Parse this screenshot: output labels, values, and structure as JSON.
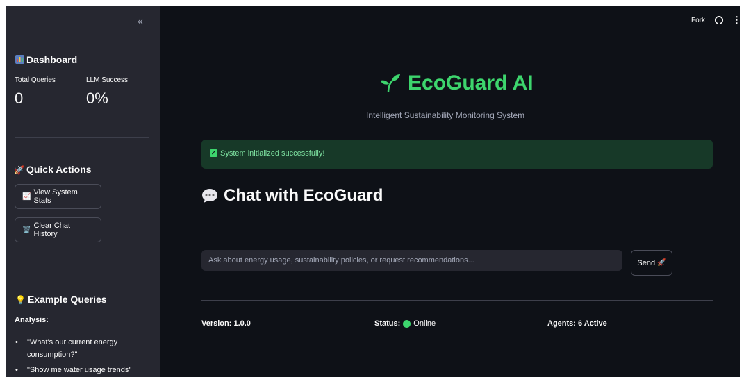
{
  "sidebar": {
    "collapse_icon": "double-chevron-left-icon",
    "dashboard": {
      "title": "Dashboard",
      "icon": "bar-chart-icon",
      "metrics": [
        {
          "label": "Total Queries",
          "value": "0"
        },
        {
          "label": "LLM Success",
          "value": "0%"
        }
      ]
    },
    "quick_actions": {
      "title": "Quick Actions",
      "icon": "rocket-icon",
      "buttons": [
        {
          "label": "View System Stats",
          "icon": "chart-icon"
        },
        {
          "label": "Clear Chat History",
          "icon": "trash-icon"
        }
      ]
    },
    "examples": {
      "title": "Example Queries",
      "icon": "lightbulb-icon",
      "category": "Analysis:",
      "items": [
        "\"What's our current energy consumption?\"",
        "\"Show me water usage trends\""
      ]
    }
  },
  "topbar": {
    "fork_label": "Fork",
    "github_icon": "github-icon",
    "menu_icon": "more-vertical-icon"
  },
  "main": {
    "title": "EcoGuard AI",
    "title_icon": "seedling-icon",
    "subtitle": "Intelligent Sustainability Monitoring System",
    "alert": "System initialized successfully!",
    "chat_heading": "Chat with EcoGuard",
    "chat_icon": "speech-bubble-icon",
    "input_placeholder": "Ask about energy usage, sustainability policies, or request recommendations...",
    "send_label": "Send",
    "footer": {
      "version": "Version: 1.0.0",
      "status_label": "Status:",
      "status_value": "Online",
      "agents": "Agents: 6 Active"
    }
  },
  "colors": {
    "sidebar_bg": "#262730",
    "main_bg": "#0e1117",
    "accent_green": "#3dd56d",
    "alert_bg": "#173928",
    "alert_text": "#7ee2a1"
  }
}
